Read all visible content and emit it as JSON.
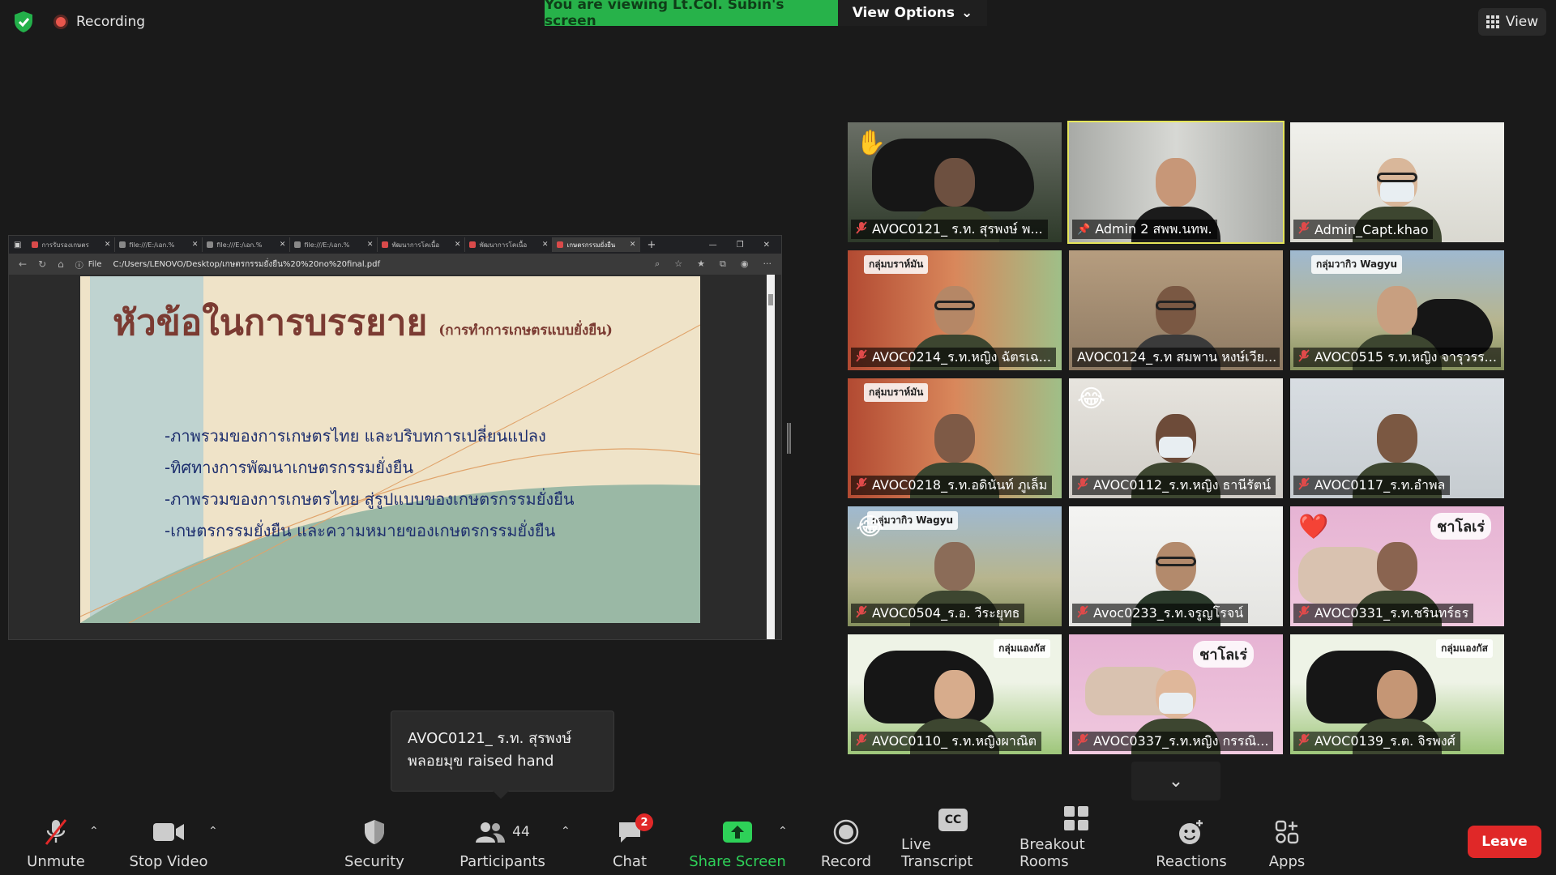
{
  "status": {
    "recording_label": "Recording"
  },
  "banner": {
    "viewing_text": "You are viewing Lt.Col. Subin's screen",
    "view_options_label": "View Options"
  },
  "view_button_label": "View",
  "shared_screen": {
    "tabs": [
      {
        "label": "การรับรองเกษตร",
        "favicon": "pdf"
      },
      {
        "label": "file:///E:/เอก.%",
        "favicon": "page"
      },
      {
        "label": "file:///E:/เอก.%",
        "favicon": "page"
      },
      {
        "label": "file:///E:/เอก.%",
        "favicon": "page"
      },
      {
        "label": "พัฒนาการโคเนื้อ",
        "favicon": "pdf"
      },
      {
        "label": "พัฒนาการโคเนื้อ",
        "favicon": "pdf"
      },
      {
        "label": "เกษตรกรรมยั่งยืน",
        "favicon": "pdf"
      }
    ],
    "active_tab_index": 6,
    "address_prefix": "File",
    "address_url": "C:/Users/LENOVO/Desktop/เกษตรกรรมยั่งยืน%20%20no%20final.pdf",
    "slide": {
      "title": "หัวข้อในการบรรยาย",
      "subtitle": "(การทำการเกษตรแบบยั่งยืน)",
      "bullets": [
        "-ภาพรวมของการเกษตรไทย และบริบทการเปลี่ยนแปลง",
        "-ทิศทางการพัฒนาเกษตรกรรมยั่งยืน",
        "-ภาพรวมของการเกษตรไทย สู่รูปแบบของเกษตรกรรมยั่งยืน",
        "-เกษตรกรรมยั่งยืน และความหมายของเกษตรกรรมยั่งยืน"
      ]
    }
  },
  "participants": [
    {
      "name": "AVOC0121_ ร.ท. สุรพงษ์ พ...",
      "muted": true,
      "raised_hand": true
    },
    {
      "name": "Admin 2 สพพ.นทพ.",
      "muted": false,
      "speaking": true
    },
    {
      "name": "Admin_Capt.khao",
      "muted": true
    },
    {
      "name": "AVOC0214_ร.ท.หญิง ฉัตรเฉ...",
      "muted": true,
      "overlay": "กลุ่มบราห์มัน"
    },
    {
      "name": "AVOC0124_ร.ท สมพาน หงษ์เวีย...",
      "muted": false
    },
    {
      "name": "AVOC0515 ร.ท.หญิง จารุวรร...",
      "muted": true,
      "overlay": "กลุ่มวากิว Wagyu"
    },
    {
      "name": "AVOC0218_ร.ท.อดินันท์ ภูเล็ม",
      "muted": true,
      "overlay": "กลุ่มบราห์มัน"
    },
    {
      "name": "AVOC0112_ร.ท.หญิง ธานีรัตน์",
      "muted": true
    },
    {
      "name": "AVOC0117_ร.ท.อำพล",
      "muted": true
    },
    {
      "name": "AVOC0504_ร.อ. วีระยุทธ",
      "muted": true,
      "overlay": "กลุ่มวากิว Wagyu"
    },
    {
      "name": "Avoc0233_ร.ท.จรูญโรจน์",
      "muted": true
    },
    {
      "name": "AVOC0331_ร.ท.ชรินทร์ธร",
      "muted": true,
      "overlay": "ชาโลเร่"
    },
    {
      "name": "AVOC0110_ ร.ท.หญิงผาณิต",
      "muted": true,
      "overlay": "กลุ่มแองกัส"
    },
    {
      "name": "AVOC0337_ร.ท.หญิง กรรณิ...",
      "muted": true,
      "overlay": "ชาโลเร่"
    },
    {
      "name": "AVOC0139_ร.ต. จิรพงศ์",
      "muted": true,
      "overlay": "กลุ่มแองกัส"
    }
  ],
  "tooltip": {
    "line1": "AVOC0121_ ร.ท. สุรพงษ์",
    "line2": "พลอยมุข raised hand"
  },
  "toolbar": {
    "unmute": "Unmute",
    "stop_video": "Stop Video",
    "security": "Security",
    "participants": "Participants",
    "participant_count": "44",
    "chat": "Chat",
    "chat_badge": "2",
    "share_screen": "Share Screen",
    "record": "Record",
    "live_transcript": "Live Transcript",
    "breakout_rooms": "Breakout Rooms",
    "reactions": "Reactions",
    "apps": "Apps",
    "leave": "Leave",
    "cc_glyph": "CC"
  },
  "colors": {
    "banner_green": "#27b24a",
    "share_green": "#2ed158",
    "leave_red": "#e02828",
    "speaking_outline": "#e5e55a"
  }
}
